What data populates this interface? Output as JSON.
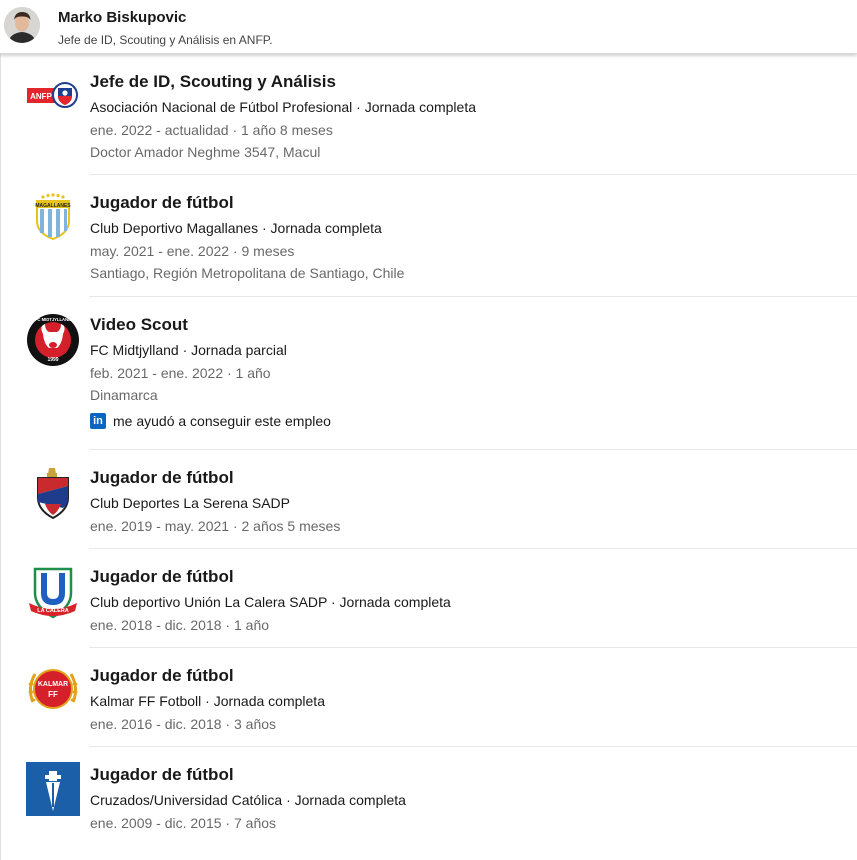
{
  "profile": {
    "name": "Marko Biskupovic",
    "headline": "Jefe de ID, Scouting y Análisis en ANFP."
  },
  "experience": [
    {
      "logo_icon": "anfp-logo-icon",
      "title": "Jefe de ID, Scouting y Análisis",
      "company": "Asociación Nacional de Fútbol Profesional · Jornada completa",
      "dates": "ene. 2022 - actualidad · 1 año 8 meses",
      "location": "Doctor Amador Neghme 3547, Macul"
    },
    {
      "logo_icon": "magallanes-crest-icon",
      "title": "Jugador de fútbol",
      "company": "Club Deportivo Magallanes · Jornada completa",
      "dates": "may. 2021 - ene. 2022 · 9 meses",
      "location": "Santiago, Región Metropolitana de Santiago, Chile"
    },
    {
      "logo_icon": "fc-midtjylland-crest-icon",
      "title": "Video Scout",
      "company": "FC Midtjylland · Jornada parcial",
      "dates": "feb. 2021 - ene. 2022 · 1 año",
      "location": "Dinamarca",
      "helped_text": "me ayudó a conseguir este empleo",
      "helped_icon": "linkedin-icon"
    },
    {
      "logo_icon": "la-serena-crest-icon",
      "title": "Jugador de fútbol",
      "company": "Club Deportes La Serena SADP",
      "dates": "ene. 2019 - may. 2021 · 2 años 5 meses"
    },
    {
      "logo_icon": "union-la-calera-crest-icon",
      "title": "Jugador de fútbol",
      "company": "Club deportivo Unión La Calera SADP · Jornada completa",
      "dates": "ene. 2018 - dic. 2018 · 1 año"
    },
    {
      "logo_icon": "kalmar-ff-crest-icon",
      "title": "Jugador de fútbol",
      "company": "Kalmar FF Fotboll · Jornada completa",
      "dates": "ene. 2016 - dic. 2018 · 3 años"
    },
    {
      "logo_icon": "universidad-catolica-crest-icon",
      "title": "Jugador de fútbol",
      "company": "Cruzados/Universidad Católica · Jornada completa",
      "dates": "ene. 2009 - dic. 2015 · 7 años"
    }
  ],
  "logo_lettering": {
    "anfp": "ANFP",
    "magallanes": "MAGALLANES",
    "midtjylland": "FC MIDTJYLLAND",
    "midtjylland_year": "1999",
    "la_calera_u": "U",
    "la_calera": "LA CALERA",
    "kalmar": "KALMAR",
    "kalmar_ff": "FF"
  },
  "colors": {
    "linkedin_blue": "#0a66c2",
    "text_primary": "rgba(0,0,0,0.9)",
    "text_secondary": "rgba(0,0,0,0.6)"
  }
}
